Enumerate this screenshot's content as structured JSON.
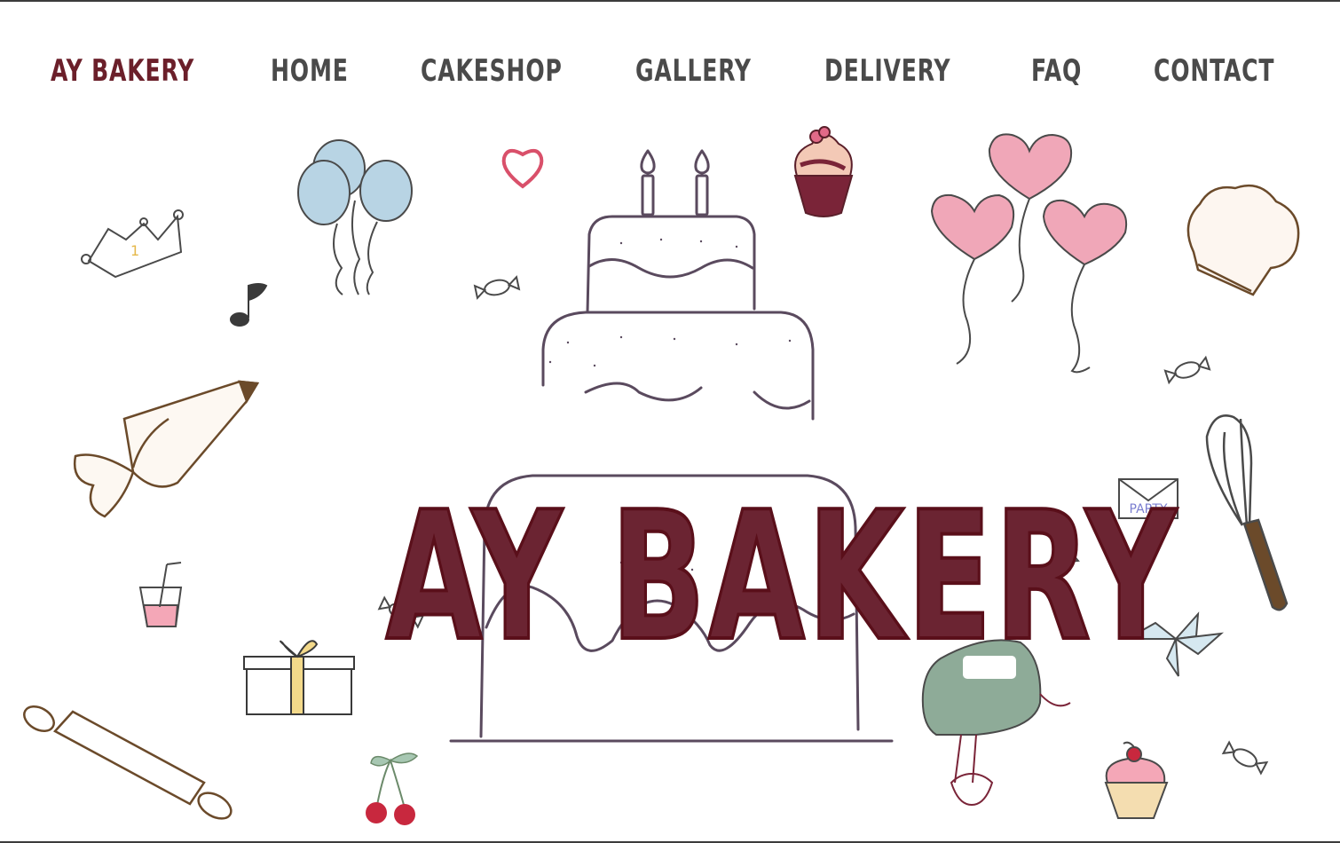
{
  "nav": {
    "brand": "AY BAKERY",
    "items": [
      {
        "id": "home",
        "label": "HOME"
      },
      {
        "id": "cakeshop",
        "label": "CAKESHOP"
      },
      {
        "id": "gallery",
        "label": "GALLERY"
      },
      {
        "id": "delivery",
        "label": "DELIVERY"
      },
      {
        "id": "faq",
        "label": "FAQ"
      },
      {
        "id": "contact",
        "label": "CONTACT"
      }
    ]
  },
  "hero": {
    "title": "AY BAKERY"
  },
  "illustrations": {
    "envelope_text": "PARTY",
    "crown_text": "1"
  },
  "colors": {
    "brand": "#6b1f2a",
    "nav_text": "#4a4a4a",
    "hero_fill": "#6b2432",
    "line_art": "#5a4a5e",
    "balloon_blue": "#b8d4e4",
    "heart_pink": "#f0a7b8",
    "mixer_green": "#8eab98"
  }
}
